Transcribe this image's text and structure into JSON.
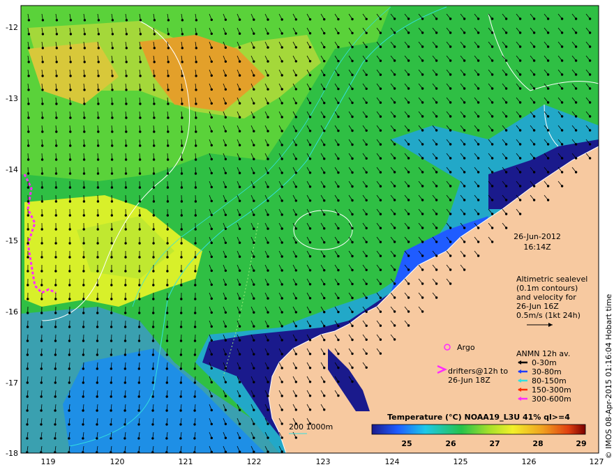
{
  "map": {
    "lon_ticks": [
      "119",
      "120",
      "121",
      "122",
      "123",
      "124",
      "125",
      "126",
      "127"
    ],
    "lat_ticks": [
      "-12",
      "-13",
      "-14",
      "-15",
      "-16",
      "-17",
      "-18"
    ],
    "date": "26-Jun-2012",
    "time": "16:14Z",
    "altimetry_lines": [
      "Altimetric sealevel",
      "(0.1m contours)",
      "and velocity for",
      "26-Jun 16Z"
    ],
    "velocity_scale": "0.5m/s (1kt 24h)",
    "argo_label": "Argo",
    "drifters_lines": [
      "drifters@12h to",
      "26-Jun 18Z"
    ],
    "anmn_title": "ANMN 12h av.",
    "anmn_depths": [
      {
        "label": "0-30m",
        "color": "#000000"
      },
      {
        "label": "30-80m",
        "color": "#1f3dff"
      },
      {
        "label": "80-150m",
        "color": "#33e0e0"
      },
      {
        "label": "150-300m",
        "color": "#ff2a00"
      },
      {
        "label": "300-600m",
        "color": "#ff2aff"
      }
    ],
    "isobath_label": "200  1000m",
    "colorbar_title": "Temperature (°C) NOAA19_L3U 41% ql>=4",
    "colorbar_ticks": [
      "25",
      "26",
      "27",
      "28",
      "29"
    ],
    "credit": "© IMOS 08-Apr-2015 01:16:04 Hobart time",
    "colors": {
      "land": "#f7c9a0",
      "sst_cold": "#1a1a8c",
      "sst_cool": "#1e8fe6",
      "sst_mid": "#27c24a",
      "sst_warm": "#d8f02a",
      "sst_hot": "#f0a020"
    }
  }
}
